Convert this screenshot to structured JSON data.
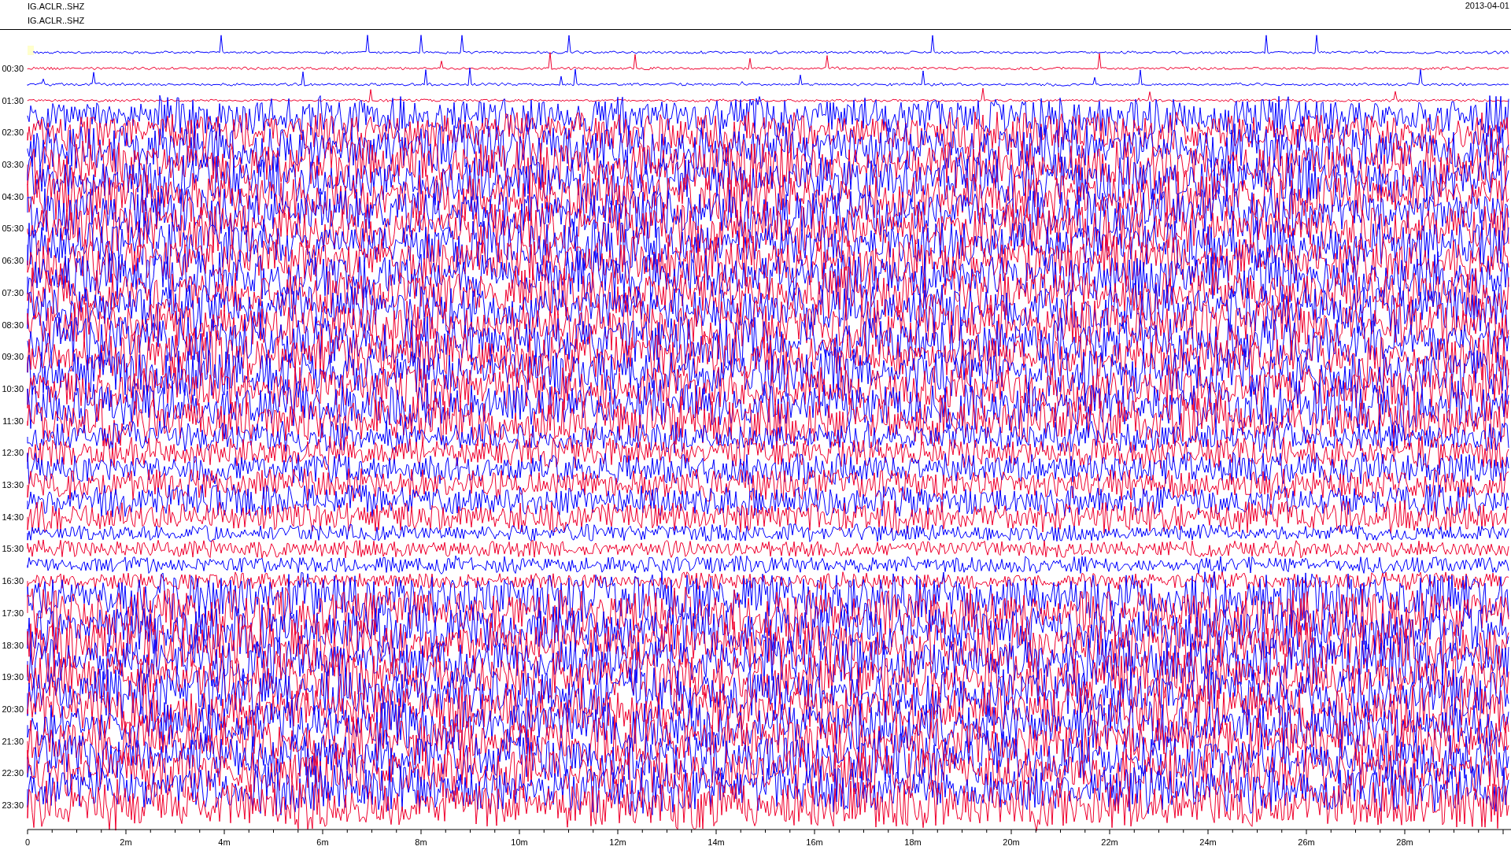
{
  "header": {
    "station_lines": [
      "IG.ACLR..SHZ",
      "IG.ACLR..SHZ"
    ],
    "date": "2013-04-01"
  },
  "y_labels": [
    "00:30",
    "01:30",
    "02:30",
    "03:30",
    "04:30",
    "05:30",
    "06:30",
    "07:30",
    "08:30",
    "09:30",
    "10:30",
    "11:30",
    "12:30",
    "13:30",
    "14:30",
    "15:30",
    "16:30",
    "17:30",
    "18:30",
    "19:30",
    "20:30",
    "21:30",
    "22:30",
    "23:30"
  ],
  "x_labels": [
    "0",
    "2m",
    "4m",
    "6m",
    "8m",
    "10m",
    "12m",
    "14m",
    "16m",
    "18m",
    "20m",
    "22m",
    "24m",
    "26m",
    "28m"
  ]
}
